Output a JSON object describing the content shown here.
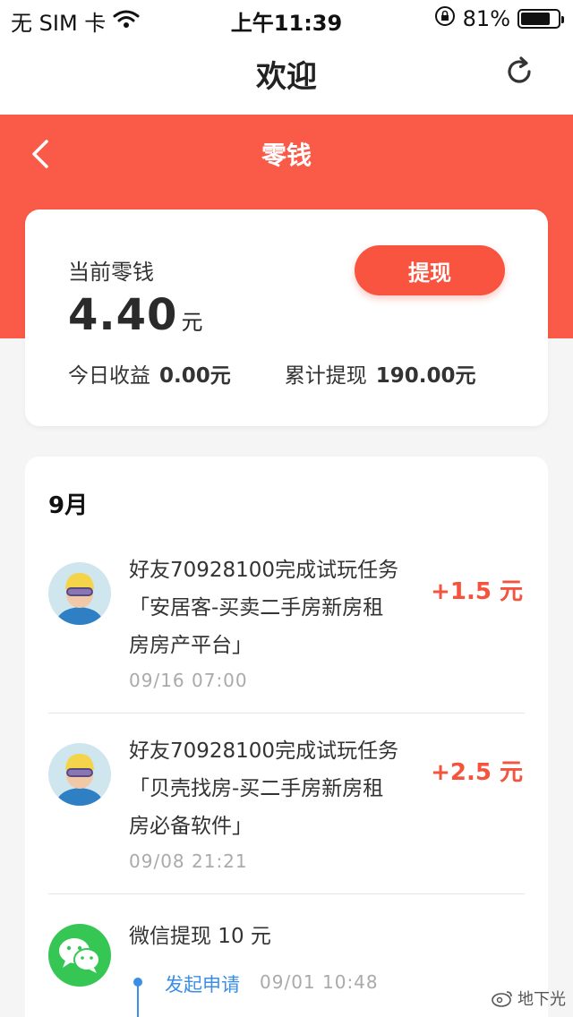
{
  "status_bar": {
    "carrier": "无 SIM 卡",
    "time": "上午11:39",
    "battery_text": "81%",
    "battery_level": 0.81
  },
  "nav": {
    "title": "欢迎"
  },
  "page": {
    "title": "零钱"
  },
  "balance": {
    "label": "当前零钱",
    "value": "4.40",
    "unit": "元",
    "withdraw_label": "提现",
    "today_label": "今日收益",
    "today_value": "0.00元",
    "total_label": "累计提现",
    "total_value": "190.00元"
  },
  "records": {
    "month": "9月",
    "items": [
      {
        "line1": "好友70928100完成试玩任务",
        "line2": "「安居客-买卖二手房新房租",
        "line3": "房房产平台」",
        "time": "09/16 07:00",
        "amount": "+1.5 元"
      },
      {
        "line1": "好友70928100完成试玩任务",
        "line2": "「贝壳找房-买二手房新房租",
        "line3": "房必备软件」",
        "time": "09/08 21:21",
        "amount": "+2.5 元"
      }
    ],
    "withdrawal": {
      "title": "微信提现 10 元",
      "step1_label": "发起申请",
      "step1_time": "09/01 10:48"
    }
  },
  "watermark": {
    "text": "地下光"
  },
  "colors": {
    "accent": "#fa5a48",
    "amount": "#f5533d",
    "timeline": "#3b8ee5",
    "wechat": "#35c653"
  }
}
